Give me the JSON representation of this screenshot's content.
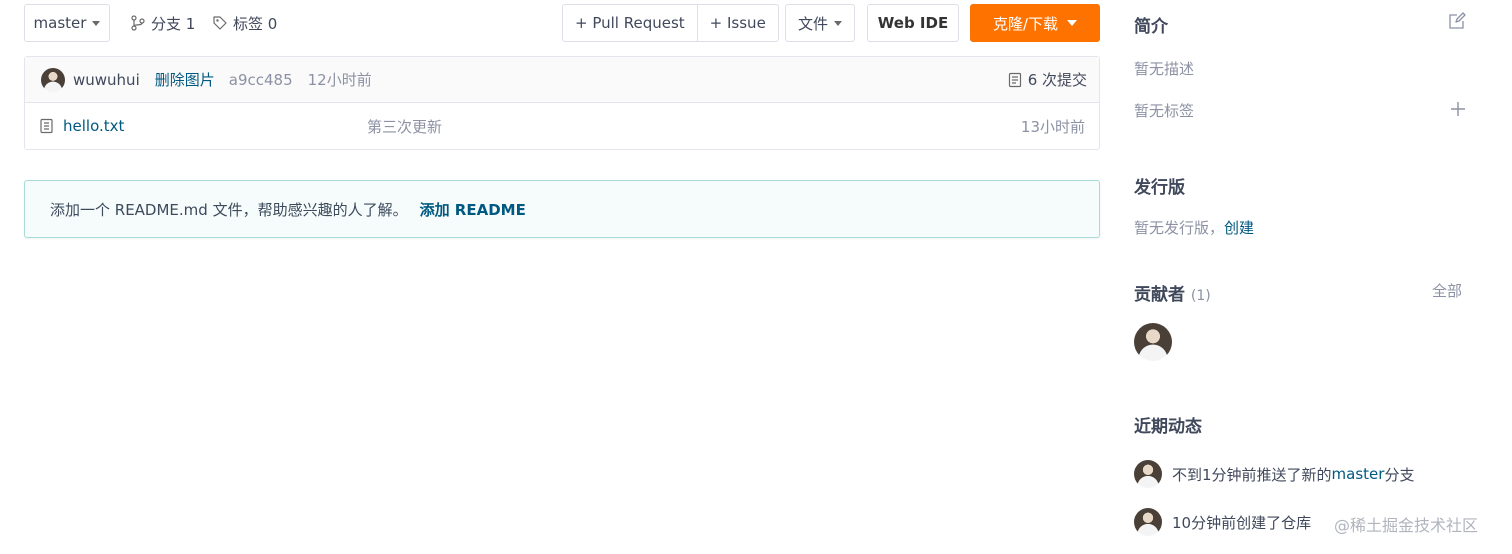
{
  "toolbar": {
    "branch": "master",
    "branches_label": "分支 1",
    "tags_label": "标签 0",
    "pull_request": "+ Pull Request",
    "issue": "+ Issue",
    "files": "文件",
    "web_ide": "Web IDE",
    "clone": "克隆/下载"
  },
  "commit": {
    "author": "wuwuhui",
    "message": "删除图片",
    "sha": "a9cc485",
    "time": "12小时前",
    "count": "6 次提交"
  },
  "files": [
    {
      "name": "hello.txt",
      "message": "第三次更新",
      "time": "13小时前"
    }
  ],
  "readme": {
    "text": "添加一个 README.md 文件，帮助感兴趣的人了解。",
    "link": "添加 README"
  },
  "sidebar": {
    "intro_title": "简介",
    "no_description": "暂无描述",
    "no_tags": "暂无标签",
    "release_title": "发行版",
    "no_release": "暂无发行版，",
    "create_link": "创建",
    "contributors_title": "贡献者",
    "contributors_count": "(1)",
    "all_link": "全部",
    "activity_title": "近期动态",
    "activities": [
      {
        "prefix": "不到1分钟前推送了新的 ",
        "branch": "master",
        "suffix": " 分支"
      },
      {
        "text": "10分钟前创建了仓库"
      }
    ]
  },
  "watermark": "@稀土掘金技术社区",
  "colors": {
    "accent": "#fe7300",
    "link": "#005980",
    "readme_border": "#a7dbd8"
  },
  "icons": [
    "branch-icon",
    "tag-icon",
    "commit-log-icon",
    "file-text-icon",
    "edit-icon",
    "plus-icon"
  ]
}
